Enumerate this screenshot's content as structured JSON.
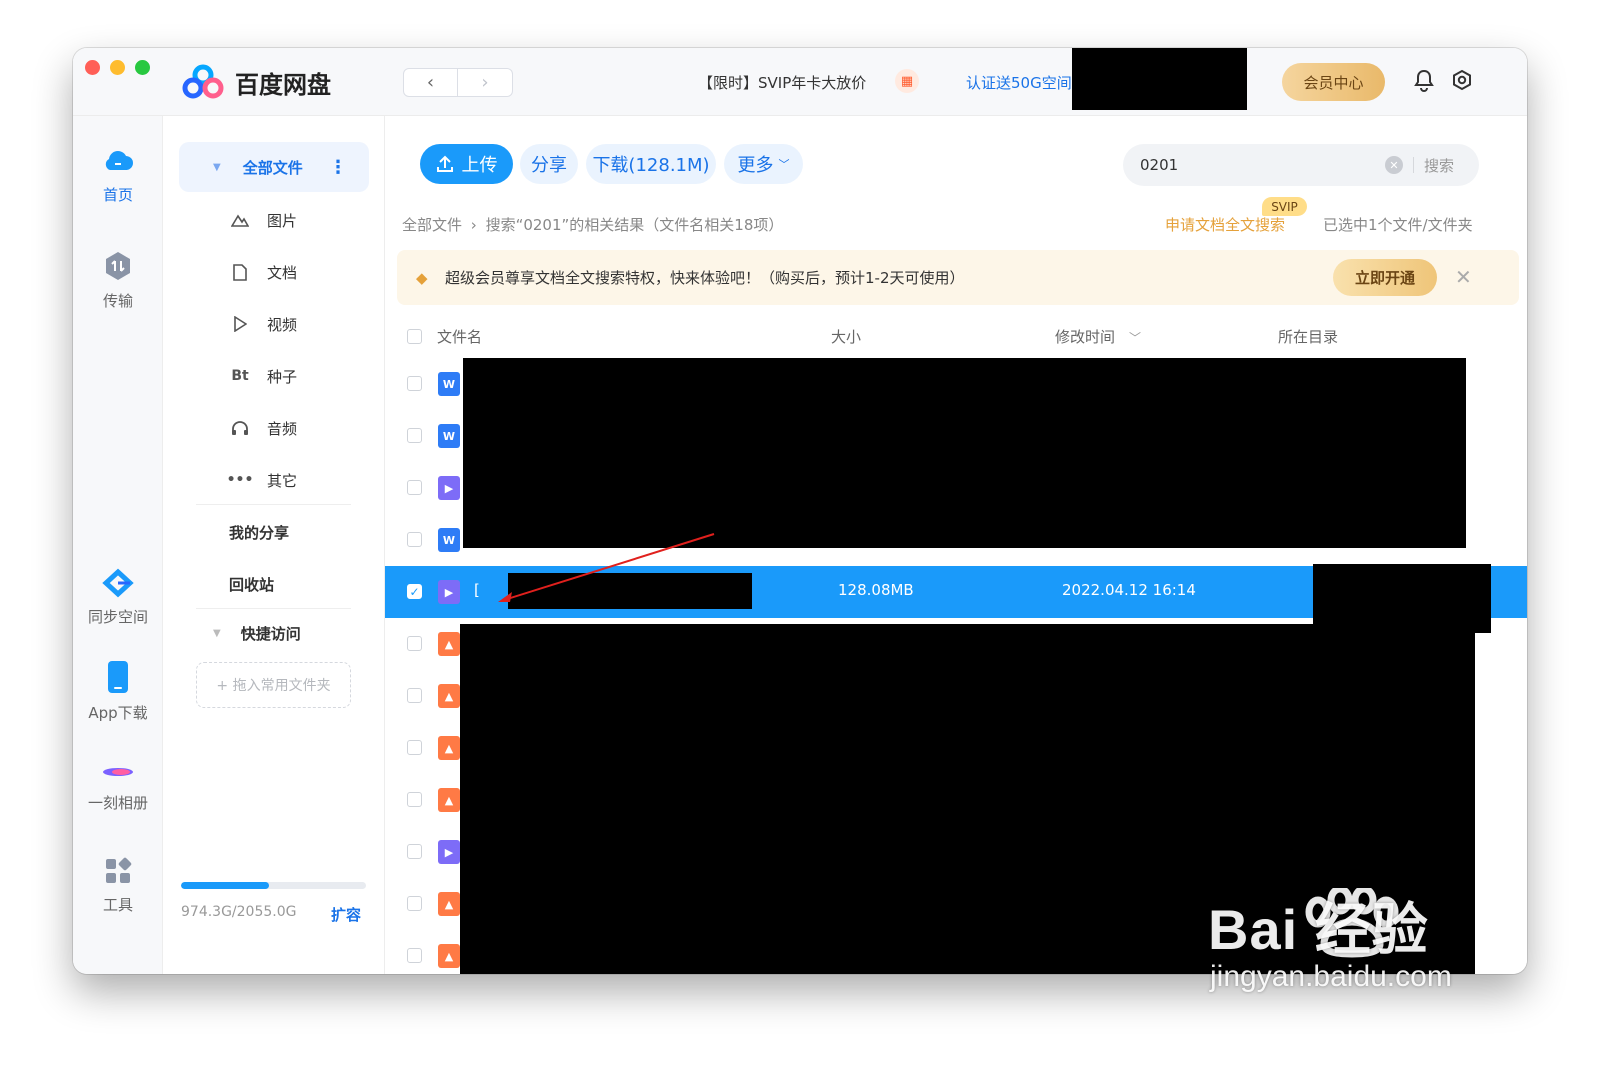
{
  "app": {
    "title": "百度网盘"
  },
  "titlebar": {
    "back_icon": "chevron-left-icon",
    "forward_icon": "chevron-right-icon",
    "promo": "【限时】SVIP年卡大放价",
    "gift_icon": "gift-icon",
    "cert_link": "认证送50G空间",
    "vip_center": "会员中心",
    "bell_icon": "bell-icon",
    "settings_icon": "gear-icon"
  },
  "rail": {
    "items": [
      {
        "label": "首页",
        "icon": "cloud-icon",
        "active": true
      },
      {
        "label": "传输",
        "icon": "transfer-icon",
        "active": false
      },
      {
        "label": "同步空间",
        "icon": "sync-icon",
        "active": false
      },
      {
        "label": "App下载",
        "icon": "phone-icon",
        "active": false
      },
      {
        "label": "一刻相册",
        "icon": "album-icon",
        "active": false
      },
      {
        "label": "工具",
        "icon": "grid-icon",
        "active": false
      }
    ]
  },
  "sidebar": {
    "all_files": "全部文件",
    "categories": [
      {
        "label": "图片",
        "icon": "image-icon"
      },
      {
        "label": "文档",
        "icon": "document-icon"
      },
      {
        "label": "视频",
        "icon": "play-icon"
      },
      {
        "label": "种子",
        "icon": "bt-icon",
        "glyph": "Bt"
      },
      {
        "label": "音频",
        "icon": "headphones-icon"
      },
      {
        "label": "其它",
        "icon": "ellipsis-icon"
      }
    ],
    "my_share": "我的分享",
    "recycle": "回收站",
    "quick_access": "快捷访问",
    "drop_hint": "+ 拖入常用文件夹",
    "storage": {
      "used_text": "974.3G/2055.0G",
      "fraction": 0.474,
      "expand": "扩容"
    }
  },
  "toolbar": {
    "upload": "上传",
    "share": "分享",
    "download": "下载(128.1M)",
    "more": "更多"
  },
  "search": {
    "value": "0201",
    "button": "搜索"
  },
  "breadcrumb": {
    "root": "全部文件",
    "current": "搜索“0201”的相关结果（文件名相关18项）"
  },
  "fulltext": {
    "badge": "SVIP",
    "label": "申请文档全文搜索"
  },
  "selection_info": "已选中1个文件/文件夹",
  "banner": {
    "text": "超级会员尊享文档全文搜索特权，快来体验吧！（购买后，预计1-2天可使用）",
    "cta": "立即开通"
  },
  "table": {
    "columns": {
      "name": "文件名",
      "size": "大小",
      "modified": "修改时间",
      "dir": "所在目录"
    },
    "rows": [
      {
        "type": "doc",
        "glyph": "W"
      },
      {
        "type": "doc",
        "glyph": "W"
      },
      {
        "type": "video",
        "glyph": "▶"
      },
      {
        "type": "doc",
        "glyph": "W"
      },
      {
        "type": "video",
        "glyph": "▶",
        "selected": true,
        "name": "[",
        "size": "128.08MB",
        "modified": "2022.04.12 16:14"
      },
      {
        "type": "image",
        "glyph": "▲"
      },
      {
        "type": "image",
        "glyph": "▲"
      },
      {
        "type": "image",
        "glyph": "▲"
      },
      {
        "type": "image",
        "glyph": "▲"
      },
      {
        "type": "video",
        "glyph": "▶"
      },
      {
        "type": "image",
        "glyph": "▲"
      },
      {
        "type": "image",
        "glyph": "▲"
      }
    ]
  },
  "watermark": {
    "main": "Bai  经验",
    "sub": "jingyan.baidu.com"
  },
  "colors": {
    "accent": "#1a9afa",
    "link": "#1a73e8",
    "gold": "#e5a13a",
    "banner_bg": "#fdf6e8"
  }
}
